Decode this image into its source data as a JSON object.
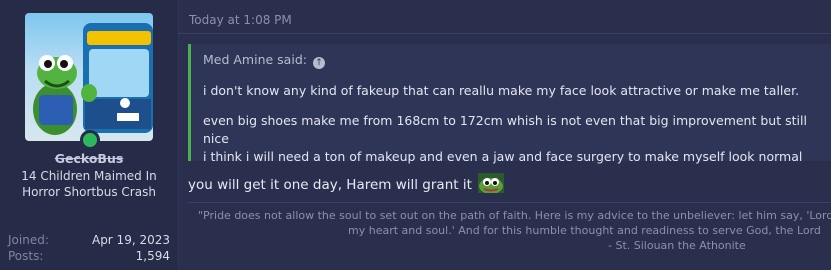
{
  "user": {
    "username": "GeckoBus",
    "title": "14 Children Maimed In Horror Shortbus Crash",
    "online": true,
    "stats": {
      "joined_label": "Joined:",
      "joined_value": "Apr 19, 2023",
      "posts_label": "Posts:",
      "posts_value": "1,594"
    }
  },
  "post": {
    "timestamp": "Today at 1:08 PM",
    "quote": {
      "author_line": "Med Amine said:",
      "paragraph1": "i don't know any kind of fakeup that can reallu make my face look attractive or make me taller.",
      "paragraph2_line1": "even big shoes make me from 168cm to 172cm whish is not even that big improvement but still nice",
      "paragraph2_line2": "i think i will need a ton of makeup and even a jaw and face surgery to make myself look normal"
    },
    "reply_text": "you will get it one day, Harem will grant it",
    "signature": {
      "line1": "\"Pride does not allow the soul to set out on the path of faith. Here is my advice to the unbeliever: let him say, 'Lord",
      "line2": "my heart and soul.' And for this humble thought and readiness to serve God, the Lord",
      "line3": "- St. Silouan the Athonite"
    }
  },
  "colors": {
    "accent_green": "#4caf50",
    "online_dot": "#2eb85c"
  }
}
